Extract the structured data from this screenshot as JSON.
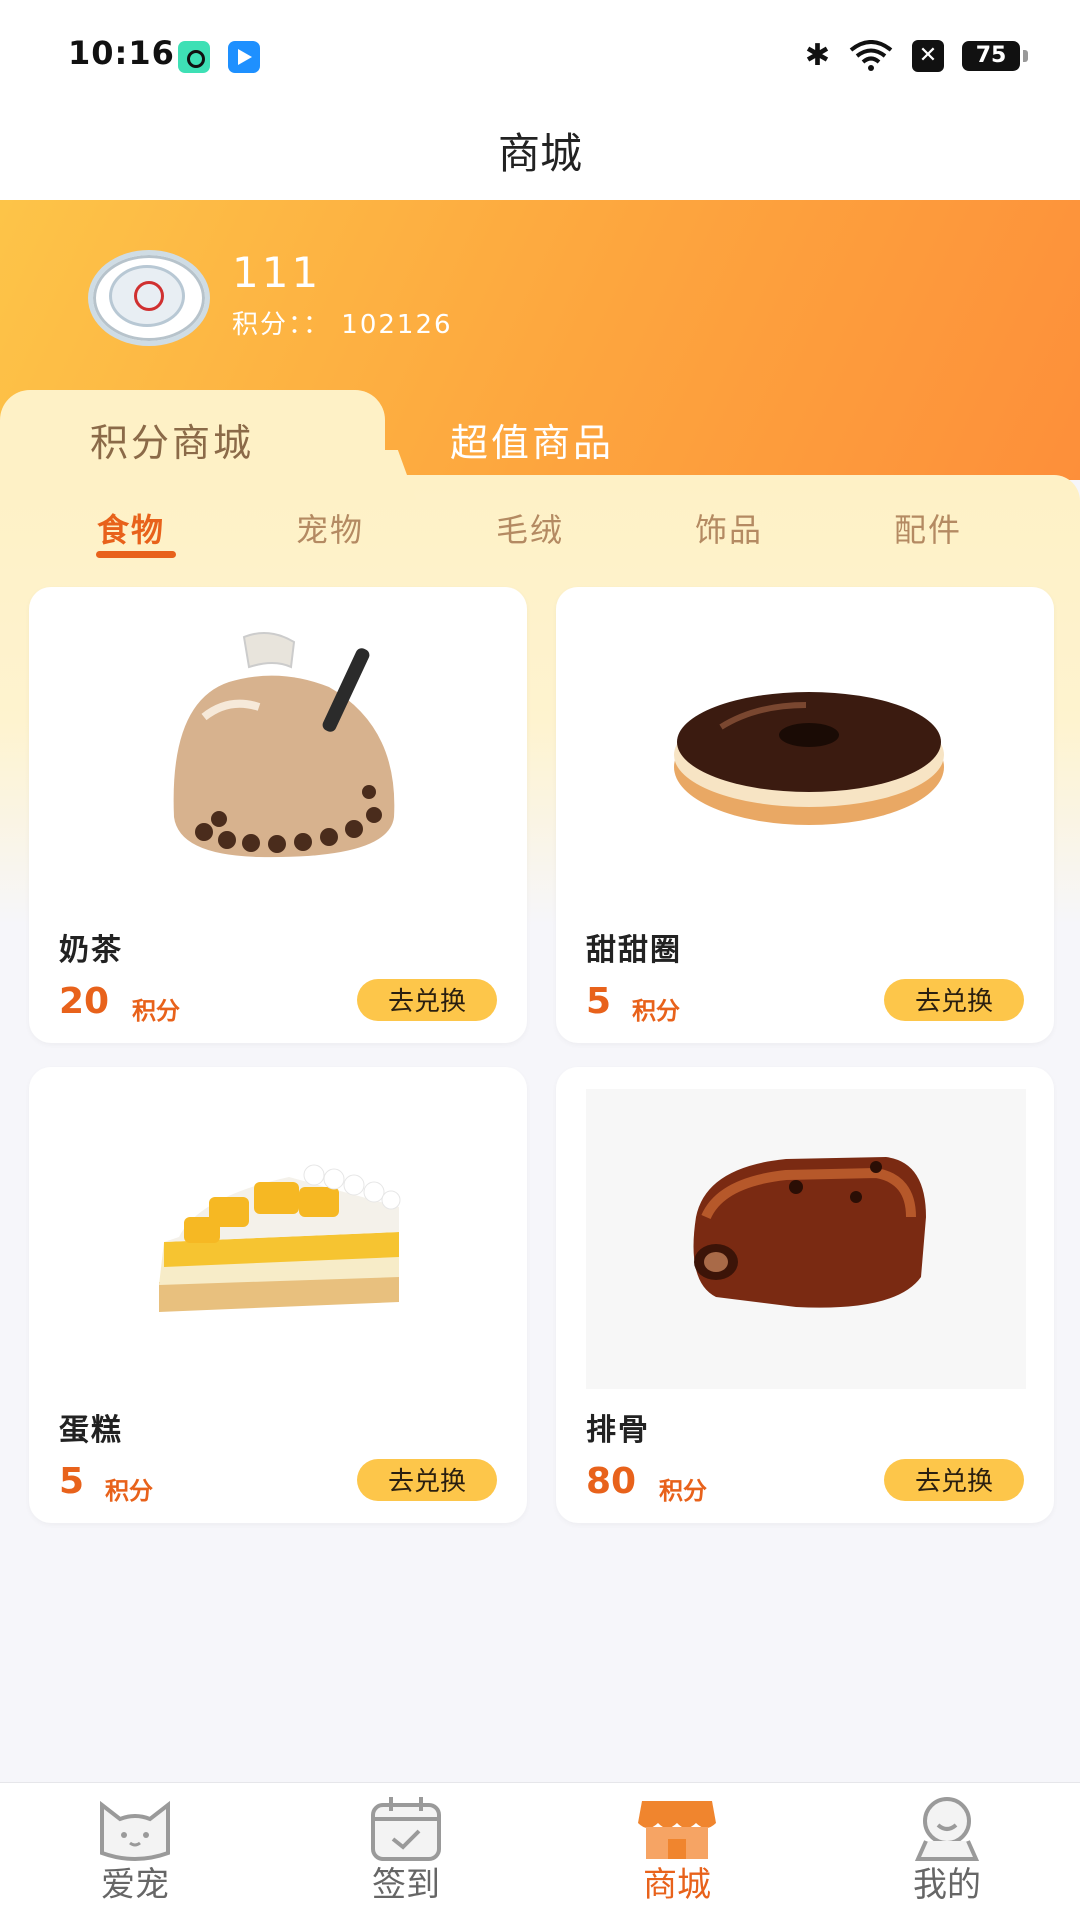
{
  "status_bar": {
    "time": "10:16",
    "battery": "75"
  },
  "title": "商城",
  "user": {
    "name": "111",
    "points_label": "积分：：",
    "points_value": "102126"
  },
  "store_tabs": [
    {
      "label": "积分商城"
    },
    {
      "label": "超值商品"
    }
  ],
  "categories": [
    {
      "label": "食物"
    },
    {
      "label": "宠物"
    },
    {
      "label": "毛绒"
    },
    {
      "label": "饰品"
    },
    {
      "label": "配件"
    }
  ],
  "products": [
    {
      "name": "奶茶",
      "price": "20",
      "unit": "积分",
      "button": "去兑换"
    },
    {
      "name": "甜甜圈",
      "price": "5",
      "unit": "积分",
      "button": "去兑换"
    },
    {
      "name": "蛋糕",
      "price": "5",
      "unit": "积分",
      "button": "去兑换"
    },
    {
      "name": "排骨",
      "price": "80",
      "unit": "积分",
      "button": "去兑换"
    }
  ],
  "bottom_nav": [
    {
      "label": "爱宠"
    },
    {
      "label": "签到"
    },
    {
      "label": "商城"
    },
    {
      "label": "我的"
    }
  ],
  "colors": {
    "accent": "#e8621b",
    "button": "#fdc64a",
    "header_start": "#fdc448",
    "header_end": "#fd8f3a"
  }
}
